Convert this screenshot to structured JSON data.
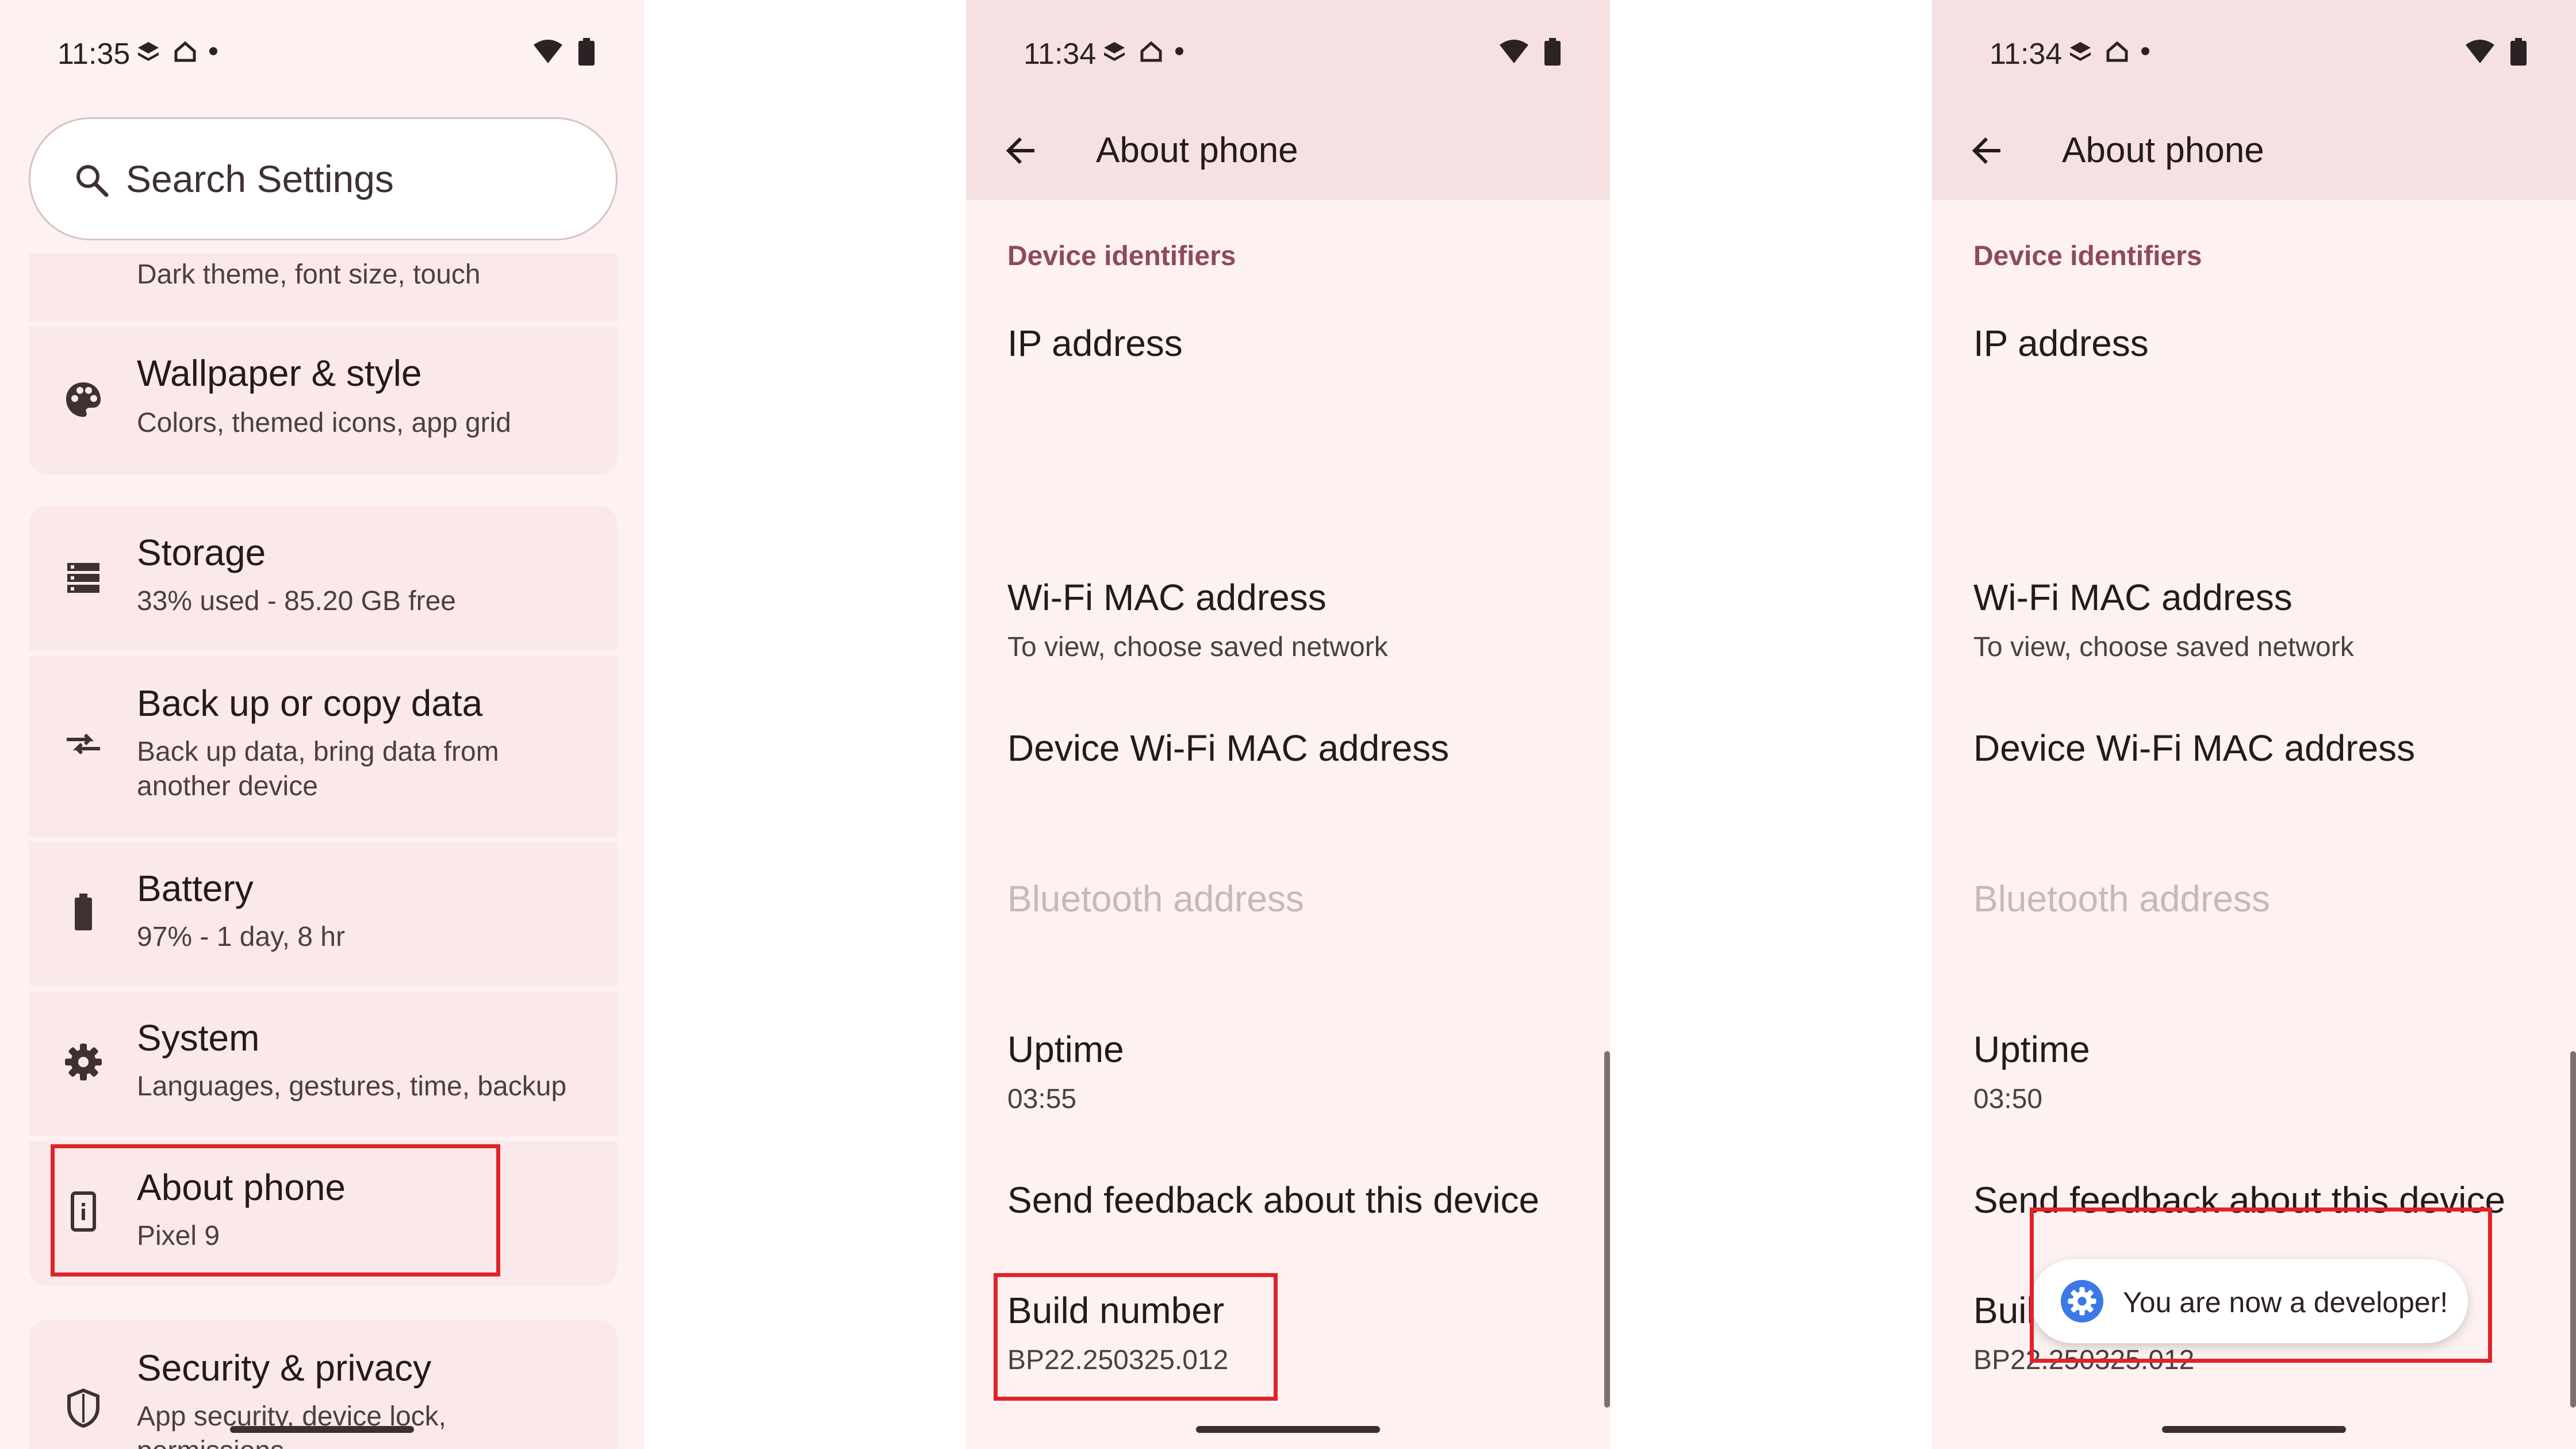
{
  "colors": {
    "highlight_box": "#e0232a",
    "section_header": "#8e4b55",
    "toast_icon": "#3c79e6"
  },
  "phone1": {
    "status_time": "11:35",
    "search_placeholder": "Search Settings",
    "items": [
      {
        "title": "",
        "subtitle": "Dark theme, font size, touch",
        "icon": "none"
      },
      {
        "title": "Wallpaper & style",
        "subtitle": "Colors, themed icons, app grid",
        "icon": "palette-icon"
      },
      {
        "title": "Storage",
        "subtitle": "33% used - 85.20 GB free",
        "icon": "storage-icon"
      },
      {
        "title": "Back up or copy data",
        "subtitle": "Back up data, bring data from",
        "subtitle2": "another device",
        "icon": "transfer-icon"
      },
      {
        "title": "Battery",
        "subtitle": "97% - 1 day, 8 hr",
        "icon": "battery-icon"
      },
      {
        "title": "System",
        "subtitle": "Languages, gestures, time, backup",
        "icon": "gear-icon"
      },
      {
        "title": "About phone",
        "subtitle": "Pixel 9",
        "icon": "info-phone-icon"
      },
      {
        "title": "Security & privacy",
        "subtitle": "App security, device lock,",
        "subtitle2": "permissions",
        "icon": "shield-icon"
      }
    ]
  },
  "phone2": {
    "status_time": "11:34",
    "title": "About phone",
    "section": "Device identifiers",
    "ip": "IP address",
    "wifi_mac": "Wi-Fi MAC address",
    "wifi_mac_sub": "To view, choose saved network",
    "device_wifi_mac": "Device Wi-Fi MAC address",
    "bluetooth": "Bluetooth address",
    "uptime": "Uptime",
    "uptime_value": "03:55",
    "feedback": "Send feedback about this device",
    "build": "Build number",
    "build_value": "BP22.250325.012"
  },
  "phone3": {
    "status_time": "11:34",
    "title": "About phone",
    "section": "Device identifiers",
    "ip": "IP address",
    "wifi_mac": "Wi-Fi MAC address",
    "wifi_mac_sub": "To view, choose saved network",
    "device_wifi_mac": "Device Wi-Fi MAC address",
    "bluetooth": "Bluetooth address",
    "uptime": "Uptime",
    "uptime_value": "03:50",
    "feedback": "Send feedback about this device",
    "build": "Build number",
    "build_value": "BP22.250325.012",
    "toast": "You are now a developer!"
  }
}
